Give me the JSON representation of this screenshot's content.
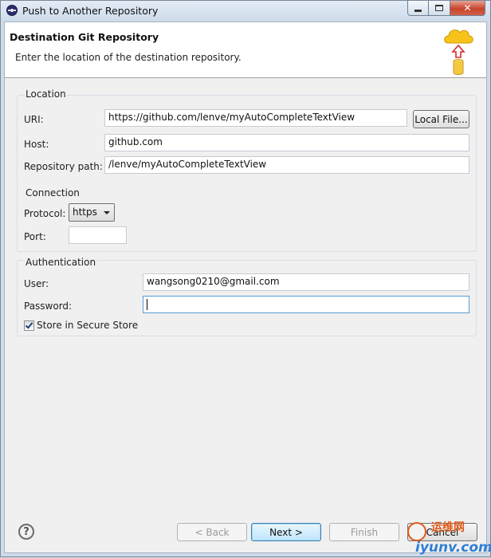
{
  "window": {
    "title": "Push to Another Repository",
    "minimize_icon": "minimize-icon",
    "maximize_icon": "maximize-icon",
    "close_glyph": "✕"
  },
  "banner": {
    "title": "Destination Git Repository",
    "description": "Enter the location of the destination repository.",
    "icon": "cloud-upload-database-icon"
  },
  "location": {
    "title": "Location",
    "uri_label": "URI:",
    "uri_value": "https://github.com/lenve/myAutoCompleteTextView",
    "local_file_button": "Local File...",
    "host_label": "Host:",
    "host_value": "github.com",
    "repo_path_label": "Repository path:",
    "repo_path_value": "/lenve/myAutoCompleteTextView"
  },
  "connection": {
    "title": "Connection",
    "protocol_label": "Protocol:",
    "protocol_value": "https",
    "port_label": "Port:",
    "port_value": ""
  },
  "authentication": {
    "title": "Authentication",
    "user_label": "User:",
    "user_value": "wangsong0210@gmail.com",
    "password_label": "Password:",
    "password_value": "",
    "store_label": "Store in Secure Store",
    "store_checked": true
  },
  "footer": {
    "help_glyph": "?",
    "back_label": "< Back",
    "next_label": "Next >",
    "finish_label": "Finish",
    "cancel_label": "Cancel"
  },
  "watermark": {
    "top_text": "运维网",
    "bottom_text": "iyunv.com"
  },
  "colors": {
    "frame": "#cfdbe8",
    "dialog_bg": "#f0f0f0",
    "close_button": "#c7442b",
    "focus_border": "#5b9bd5"
  }
}
